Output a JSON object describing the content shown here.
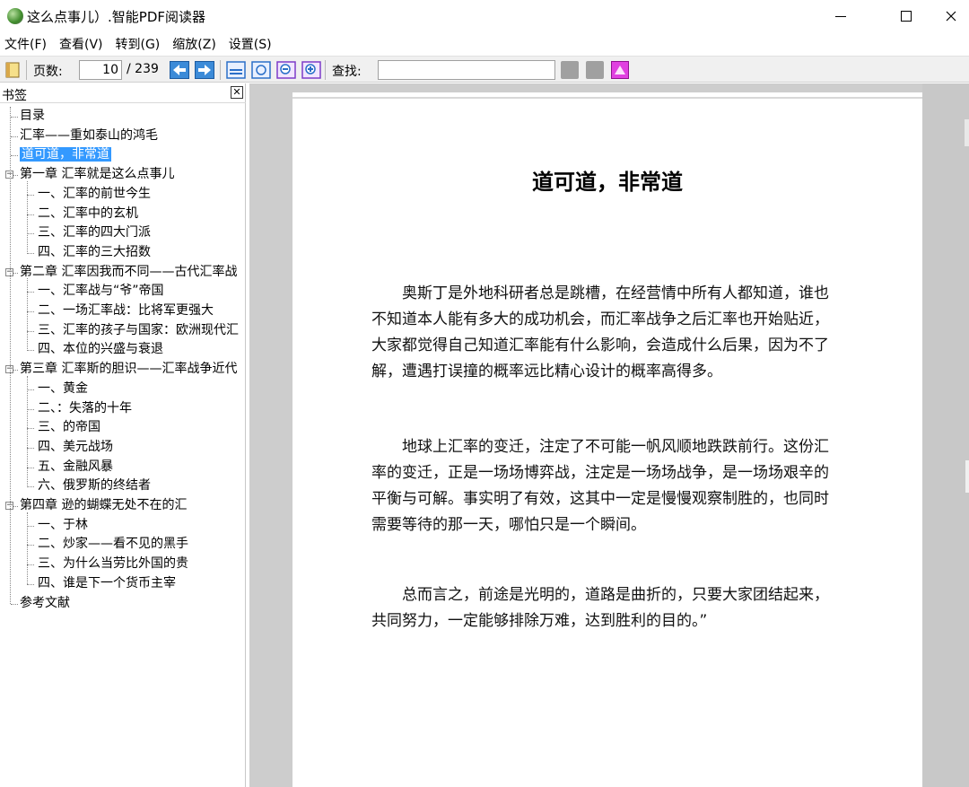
{
  "window": {
    "title": "这么点事儿）.智能PDF阅读器",
    "minimize": "—",
    "close": "✕"
  },
  "menu": [
    "文件(F)",
    "查看(V)",
    "转到(G)",
    "缩放(Z)",
    "设置(S)"
  ],
  "toolbar": {
    "page_label": "页数:",
    "page_current": "10",
    "page_total": "/ 239",
    "search_label": "查找:",
    "search_value": ""
  },
  "sidebar": {
    "title": "书签",
    "close": "✕",
    "items": [
      {
        "label": "目录"
      },
      {
        "label": "汇率——重如泰山的鸿毛"
      },
      {
        "label": "道可道，非常道",
        "selected": true
      },
      {
        "label": "第一章 汇率就是这么点事儿",
        "toggle": "−"
      },
      {
        "label": "一、汇率的前世今生"
      },
      {
        "label": "二、汇率中的玄机"
      },
      {
        "label": "三、汇率的四大门派"
      },
      {
        "label": "四、汇率的三大招数"
      },
      {
        "label": "第二章 汇率因我而不同——古代汇率战",
        "toggle": "−"
      },
      {
        "label": "一、汇率战与“爷”帝国"
      },
      {
        "label": "二、一场汇率战：比将军更强大"
      },
      {
        "label": "三、汇率的孩子与国家：欧洲现代汇"
      },
      {
        "label": "四、本位的兴盛与衰退"
      },
      {
        "label": "第三章 汇率斯的胆识——汇率战争近代",
        "toggle": "−"
      },
      {
        "label": "一、黄金"
      },
      {
        "label": "二、：失落的十年"
      },
      {
        "label": "三、的帝国"
      },
      {
        "label": "四、美元战场"
      },
      {
        "label": "五、金融风暴"
      },
      {
        "label": "六、俄罗斯的终结者"
      },
      {
        "label": "第四章 逊的蝴蝶无处不在的汇",
        "toggle": "−"
      },
      {
        "label": "一、于林"
      },
      {
        "label": "二、炒家——看不见的黑手"
      },
      {
        "label": "三、为什么当劳比外国的贵"
      },
      {
        "label": "四、谁是下一个货币主宰"
      },
      {
        "label": "参考文献"
      }
    ]
  },
  "document": {
    "title": "道可道，非常道",
    "paragraphs": [
      "奥斯丁是外地科研者总是跳槽，在经营情中所有人都知道，谁也不知道本人能有多大的成功机会，而汇率战争之后汇率也开始贴近，大家都觉得自己知道汇率能有什么影响，会造成什么后果，因为不了解，遭遇打误撞的概率远比精心设计的概率高得多。",
      "地球上汇率的变迁，注定了不可能一帆风顺地跌跌前行。这份汇率的变迁，正是一场场博弈战，注定是一场场战争，是一场场艰辛的平衡与可解。事实明了有效，这其中一定是慢慢观察制胜的，也同时需要等待的那一天，哪怕只是一个瞬间。",
      "总而言之，前途是光明的，道路是曲折的，只要大家团结起来，共同努力，一定能够排除万难，达到胜利的目的。”"
    ]
  }
}
